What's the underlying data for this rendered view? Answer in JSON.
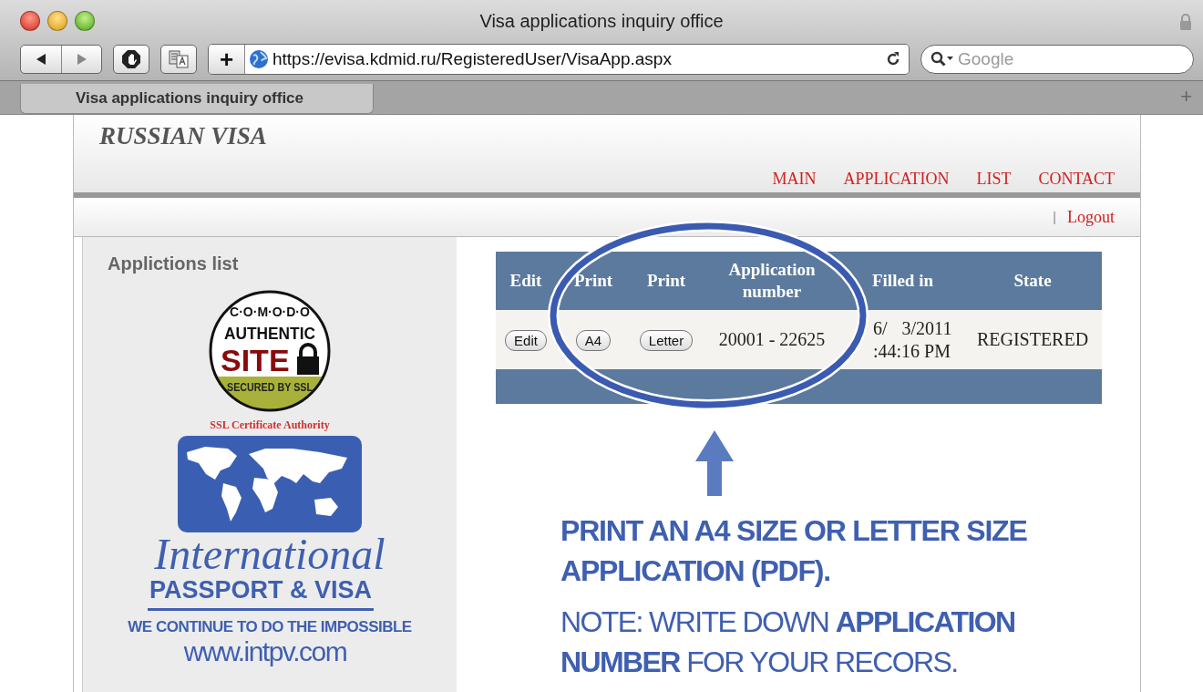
{
  "window": {
    "title": "Visa applications inquiry office"
  },
  "toolbar": {
    "url": "https://evisa.kdmid.ru/RegisteredUser/VisaApp.aspx",
    "search_placeholder": "Google",
    "new_tab_symbol": "+"
  },
  "tabs": [
    {
      "label": "Visa applications inquiry office",
      "selected": true
    }
  ],
  "site": {
    "logo": "RUSSIAN VISA",
    "nav": [
      {
        "label": "MAIN"
      },
      {
        "label": "APPLICATION"
      },
      {
        "label": "LIST"
      },
      {
        "label": "CONTACT"
      }
    ],
    "separator": "|",
    "logout": "Logout"
  },
  "sidebar": {
    "title": "Applictions list",
    "comodo_badge": {
      "top": "C·O·M·O·D·O",
      "middle": "AUTHENTIC",
      "site": "SITE",
      "bottom": "SECURED BY SSL"
    },
    "ssl_caption": "SSL Certificate Authority",
    "agency": {
      "script": "International",
      "name": "PASSPORT & VISA",
      "slogan": "WE CONTINUE TO DO THE IMPOSSIBLE",
      "url": "www.intpv.com"
    }
  },
  "table": {
    "columns": [
      "Edit",
      "Print",
      "Print",
      "Application number",
      "Filled in",
      "State"
    ],
    "rows": [
      {
        "edit": "Edit",
        "print_a4": "A4",
        "print_letter": "Letter",
        "application_number": "20001 - 22625",
        "filled_in_line_1": [
          "6/",
          "3/2011"
        ],
        "filled_in_line_2": ":44:16 PM",
        "state": "REGISTERED"
      }
    ]
  },
  "callout": {
    "heading": "PRINT AN A4 SIZE OR LETTER SIZE APPLICATION (PDF).",
    "note": "NOTE: WRITE DOWN **APPLICATION NUMBER** FOR YOUR RECORS."
  }
}
